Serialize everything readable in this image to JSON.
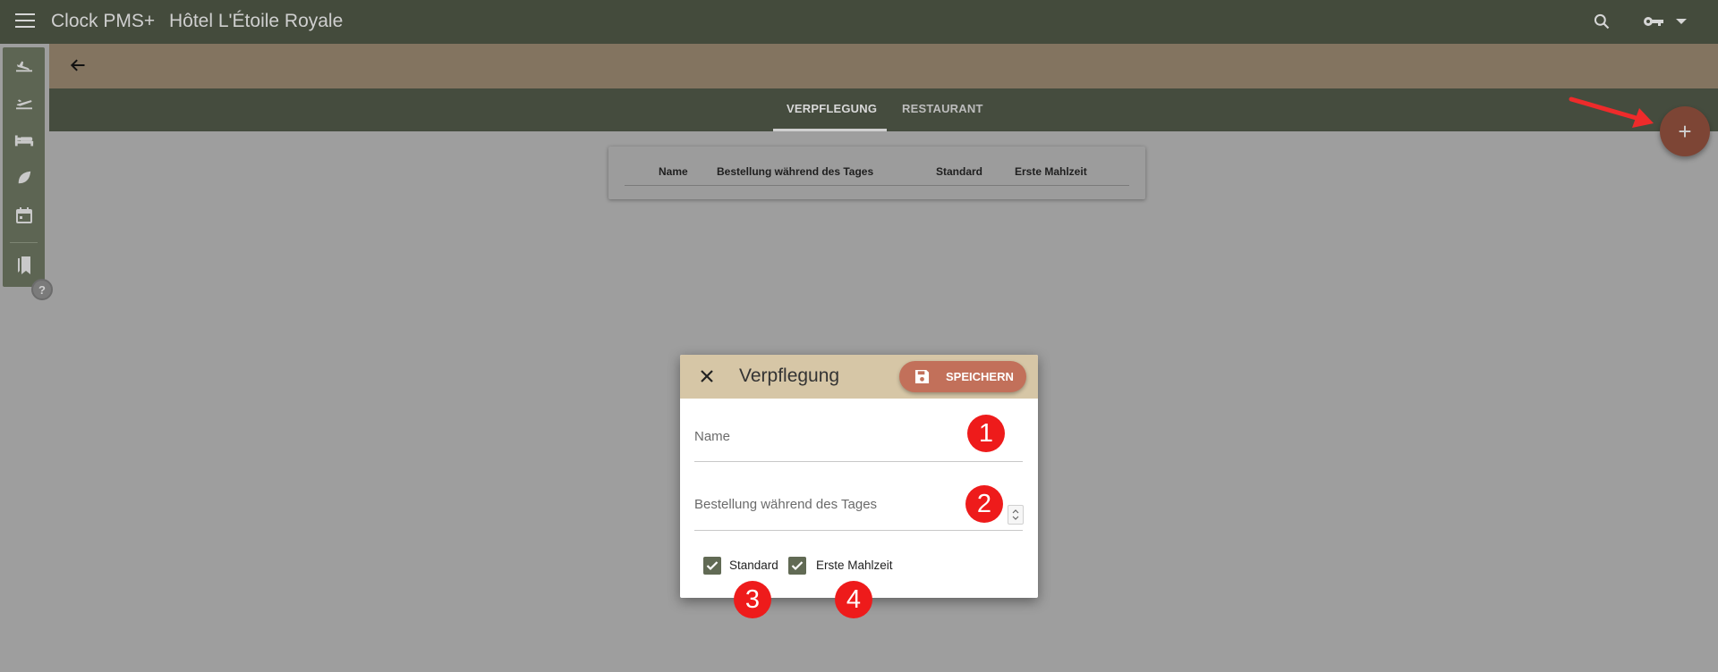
{
  "topbar": {
    "app_title": "Clock PMS+",
    "hotel_name": "Hôtel L'Étoile Royale"
  },
  "tabs": [
    {
      "label": "VERPFLEGUNG",
      "active": true
    },
    {
      "label": "RESTAURANT",
      "active": false
    }
  ],
  "sidebar": {
    "items": [
      "arrivals-icon",
      "departures-icon",
      "rooms-icon",
      "leaf-icon",
      "calendar-icon",
      "bookmarks-icon"
    ],
    "help_label": "?"
  },
  "table": {
    "headers": [
      "Name",
      "Bestellung während des Tages",
      "Standard",
      "Erste Mahlzeit"
    ]
  },
  "fab": {
    "label": "+"
  },
  "dialog": {
    "title": "Verpflegung",
    "save_label": "SPEICHERN",
    "fields": [
      {
        "label": "Name",
        "value": ""
      },
      {
        "label": "Bestellung während des Tages",
        "value": ""
      }
    ],
    "checkboxes": [
      {
        "label": "Standard",
        "checked": true
      },
      {
        "label": "Erste Mahlzeit",
        "checked": true
      }
    ]
  },
  "annotations": [
    "1",
    "2",
    "3",
    "4"
  ],
  "colors": {
    "topbar": "#444b3c",
    "subbar": "#837460",
    "dialog_header": "#d6c6a6",
    "save_button": "#c2705a",
    "fab": "#7d4535",
    "badge": "#ee1b1b"
  }
}
